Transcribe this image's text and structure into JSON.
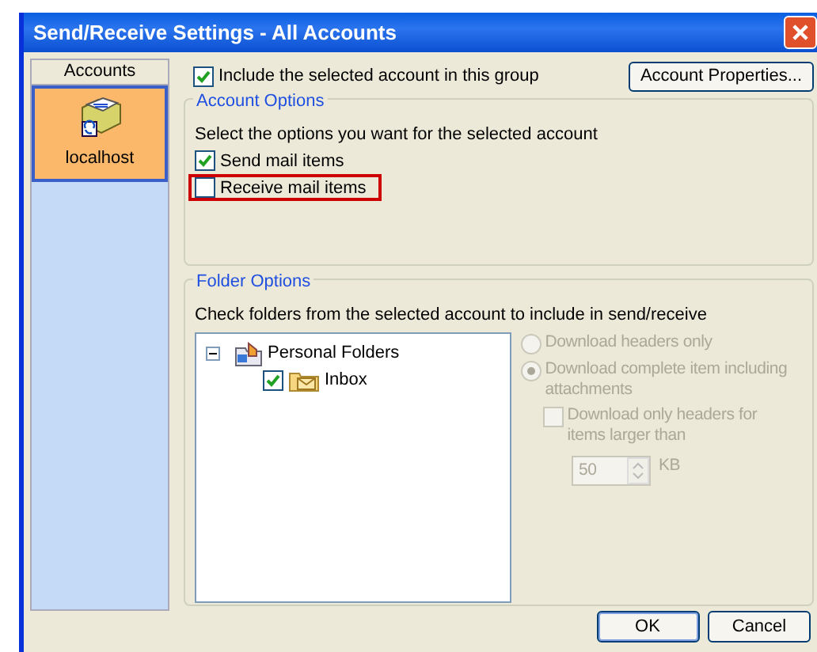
{
  "window": {
    "title": "Send/Receive Settings - All Accounts"
  },
  "accounts": {
    "header": "Accounts",
    "items": [
      {
        "label": "localhost",
        "selected": true
      }
    ]
  },
  "include_account": {
    "label": "Include the selected account in this group",
    "checked": true
  },
  "account_properties_button": "Account Properties...",
  "account_options": {
    "title": "Account Options",
    "prompt": "Select the options you want for the selected account",
    "items": [
      {
        "label": "Send mail items",
        "checked": true,
        "highlighted": false
      },
      {
        "label": "Receive mail items",
        "checked": false,
        "highlighted": true
      }
    ]
  },
  "folder_options": {
    "title": "Folder Options",
    "prompt": "Check folders from the selected account to include in send/receive",
    "tree": [
      {
        "label": "Personal Folders",
        "expanded": true,
        "children": [
          {
            "label": "Inbox",
            "checked": true
          }
        ]
      }
    ],
    "download_options": [
      {
        "kind": "radio",
        "label": "Download headers only",
        "selected": false,
        "disabled": true
      },
      {
        "kind": "radio",
        "label": "Download complete item including attachments",
        "selected": true,
        "disabled": true
      },
      {
        "kind": "checkbox",
        "label": "Download only headers for items larger than",
        "checked": false,
        "disabled": true
      },
      {
        "kind": "spinner",
        "value": "50",
        "unit": "KB",
        "disabled": true
      }
    ]
  },
  "buttons": [
    {
      "label": "OK",
      "default": true
    },
    {
      "label": "Cancel",
      "default": false
    }
  ]
}
